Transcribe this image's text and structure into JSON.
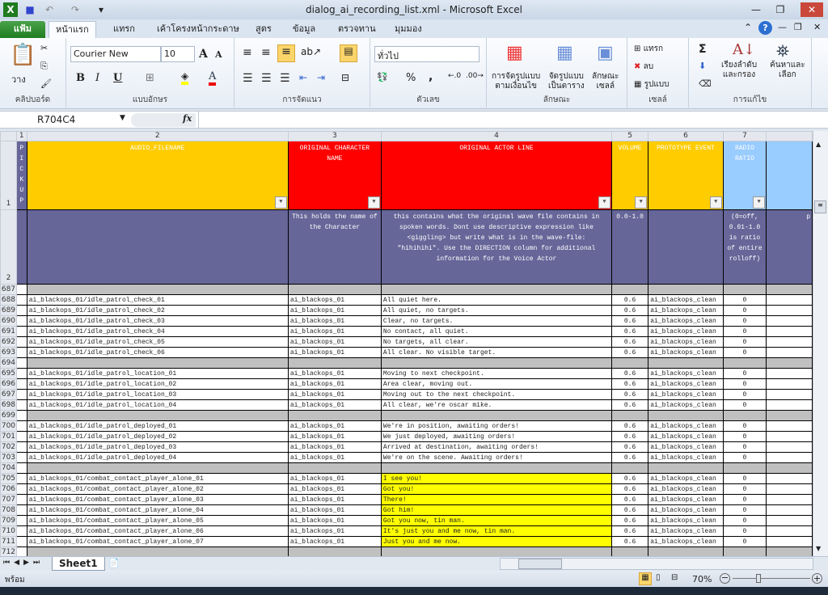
{
  "window": {
    "title": "dialog_ai_recording_list.xml - Microsoft Excel"
  },
  "quick_access": {
    "save": "save-icon",
    "undo": "undo-icon",
    "redo": "redo-icon"
  },
  "tabs": [
    {
      "label": "แฟ้ม"
    },
    {
      "label": "หน้าแรก"
    },
    {
      "label": "แทรก"
    },
    {
      "label": "เค้าโครงหน้ากระดาษ"
    },
    {
      "label": "สูตร"
    },
    {
      "label": "ข้อมูล"
    },
    {
      "label": "ตรวจทาน"
    },
    {
      "label": "มุมมอง"
    }
  ],
  "ribbon": {
    "clipboard": {
      "paste": "วาง",
      "label": "คลิปบอร์ด"
    },
    "font": {
      "name": "Courier New",
      "size": "10",
      "bold": "B",
      "italic": "I",
      "underline": "U",
      "label": "แบบอักษร"
    },
    "alignment": {
      "label": "การจัดแนว"
    },
    "number": {
      "format": "ทั่วไป",
      "percent": "%",
      "comma": ",",
      "label": "ตัวเลข"
    },
    "styles": {
      "conditional": [
        "การจัดรูปแบบ",
        "ตามเงื่อนไข"
      ],
      "table": [
        "จัดรูปแบบ",
        "เป็นตาราง"
      ],
      "cell": [
        "ลักษณะ",
        "เซลล์"
      ],
      "label": "ลักษณะ"
    },
    "cells": {
      "insert": "แทรก",
      "delete": "ลบ",
      "format": "รูปแบบ",
      "label": "เซลล์"
    },
    "editing": {
      "sum": "Σ",
      "sort": [
        "เรียงลำดับ",
        "และกรอง"
      ],
      "find": [
        "ค้นหาและ",
        "เลือก"
      ],
      "label": "การแก้ไข"
    }
  },
  "formula_bar": {
    "name_box": "R704C4",
    "fx": "fx",
    "value": ""
  },
  "columns": [
    "1",
    "2",
    "3",
    "4",
    "5",
    "6",
    "7",
    ""
  ],
  "header_row": {
    "num": "1",
    "pickup": "P I C K U P",
    "cells": [
      "AUDIO_FILENAME",
      "ORIGINAL CHARACTER NAME",
      "ORIGINAL ACTOR LINE",
      "VOLUME",
      "PROTOTYPE EVENT",
      "RADIO RATIO",
      ""
    ]
  },
  "header_colors": [
    "#ffcc00",
    "#ff0000",
    "#ff0000",
    "#ffcc00",
    "#ffcc00",
    "#99ccff",
    "#99ccff"
  ],
  "desc_row": {
    "num": "2",
    "cells": [
      "",
      "This holds the name of the Character",
      "this contains what the original wave file contains in spoken words. Dont use descriptive expression like <giggling> but write what is in the wave-file: \"hihihihi\". Use the DIRECTION column for additional information for the Voice Actor",
      "0.0-1.0",
      "",
      "(0=off, 0.01-1.0 is ratio of entire rolloff)",
      "p"
    ]
  },
  "rows": [
    {
      "num": "687",
      "blank": true
    },
    {
      "num": "688",
      "file": "ai_blackops_01/idle_patrol_check_01",
      "char": "ai_blackops_01",
      "line": "All quiet here.",
      "vol": "0.6",
      "event": "ai_blackops_clean",
      "radio": "0"
    },
    {
      "num": "689",
      "file": "ai_blackops_01/idle_patrol_check_02",
      "char": "ai_blackops_01",
      "line": "All quiet, no targets.",
      "vol": "0.6",
      "event": "ai_blackops_clean",
      "radio": "0"
    },
    {
      "num": "690",
      "file": "ai_blackops_01/idle_patrol_check_03",
      "char": "ai_blackops_01",
      "line": "Clear, no targets.",
      "vol": "0.6",
      "event": "ai_blackops_clean",
      "radio": "0"
    },
    {
      "num": "691",
      "file": "ai_blackops_01/idle_patrol_check_04",
      "char": "ai_blackops_01",
      "line": "No contact, all quiet.",
      "vol": "0.6",
      "event": "ai_blackops_clean",
      "radio": "0"
    },
    {
      "num": "692",
      "file": "ai_blackops_01/idle_patrol_check_05",
      "char": "ai_blackops_01",
      "line": "No targets, all clear.",
      "vol": "0.6",
      "event": "ai_blackops_clean",
      "radio": "0"
    },
    {
      "num": "693",
      "file": "ai_blackops_01/idle_patrol_check_06",
      "char": "ai_blackops_01",
      "line": "All clear. No visible target.",
      "vol": "0.6",
      "event": "ai_blackops_clean",
      "radio": "0"
    },
    {
      "num": "694",
      "blank": true
    },
    {
      "num": "695",
      "file": "ai_blackops_01/idle_patrol_location_01",
      "char": "ai_blackops_01",
      "line": "Moving to next checkpoint.",
      "vol": "0.6",
      "event": "ai_blackops_clean",
      "radio": "0"
    },
    {
      "num": "696",
      "file": "ai_blackops_01/idle_patrol_location_02",
      "char": "ai_blackops_01",
      "line": "Area clear, moving out.",
      "vol": "0.6",
      "event": "ai_blackops_clean",
      "radio": "0"
    },
    {
      "num": "697",
      "file": "ai_blackops_01/idle_patrol_location_03",
      "char": "ai_blackops_01",
      "line": "Moving out to the next checkpoint.",
      "vol": "0.6",
      "event": "ai_blackops_clean",
      "radio": "0"
    },
    {
      "num": "698",
      "file": "ai_blackops_01/idle_patrol_location_04",
      "char": "ai_blackops_01",
      "line": "All clear, we're oscar mike.",
      "vol": "0.6",
      "event": "ai_blackops_clean",
      "radio": "0"
    },
    {
      "num": "699",
      "blank": true
    },
    {
      "num": "700",
      "file": "ai_blackops_01/idle_patrol_deployed_01",
      "char": "ai_blackops_01",
      "line": "We're in position, awaiting orders!",
      "vol": "0.6",
      "event": "ai_blackops_clean",
      "radio": "0"
    },
    {
      "num": "701",
      "file": "ai_blackops_01/idle_patrol_deployed_02",
      "char": "ai_blackops_01",
      "line": "We just deployed, awaiting orders!",
      "vol": "0.6",
      "event": "ai_blackops_clean",
      "radio": "0"
    },
    {
      "num": "702",
      "file": "ai_blackops_01/idle_patrol_deployed_03",
      "char": "ai_blackops_01",
      "line": "Arrived at destination, awaiting orders!",
      "vol": "0.6",
      "event": "ai_blackops_clean",
      "radio": "0"
    },
    {
      "num": "703",
      "file": "ai_blackops_01/idle_patrol_deployed_04",
      "char": "ai_blackops_01",
      "line": "We're on the scene. Awaiting orders!",
      "vol": "0.6",
      "event": "ai_blackops_clean",
      "radio": "0"
    },
    {
      "num": "704",
      "blank": true
    },
    {
      "num": "705",
      "file": "ai_blackops_01/combat_contact_player_alone_01",
      "char": "ai_blackops_01",
      "line": "I see you!",
      "vol": "0.6",
      "event": "ai_blackops_clean",
      "radio": "0",
      "highlight": true
    },
    {
      "num": "706",
      "file": "ai_blackops_01/combat_contact_player_alone_02",
      "char": "ai_blackops_01",
      "line": "Got you!",
      "vol": "0.6",
      "event": "ai_blackops_clean",
      "radio": "0",
      "highlight": true
    },
    {
      "num": "707",
      "file": "ai_blackops_01/combat_contact_player_alone_03",
      "char": "ai_blackops_01",
      "line": "There!",
      "vol": "0.6",
      "event": "ai_blackops_clean",
      "radio": "0",
      "highlight": true
    },
    {
      "num": "708",
      "file": "ai_blackops_01/combat_contact_player_alone_04",
      "char": "ai_blackops_01",
      "line": "Got him!",
      "vol": "0.6",
      "event": "ai_blackops_clean",
      "radio": "0",
      "highlight": true
    },
    {
      "num": "709",
      "file": "ai_blackops_01/combat_contact_player_alone_05",
      "char": "ai_blackops_01",
      "line": "Got you now, tin man.",
      "vol": "0.6",
      "event": "ai_blackops_clean",
      "radio": "0",
      "highlight": true
    },
    {
      "num": "710",
      "file": "ai_blackops_01/combat_contact_player_alone_06",
      "char": "ai_blackops_01",
      "line": "It's just you and me now, tin man.",
      "vol": "0.6",
      "event": "ai_blackops_clean",
      "radio": "0",
      "highlight": true
    },
    {
      "num": "711",
      "file": "ai_blackops_01/combat_contact_player_alone_07",
      "char": "ai_blackops_01",
      "line": "Just you and me now.",
      "vol": "0.6",
      "event": "ai_blackops_clean",
      "radio": "0",
      "highlight": true
    },
    {
      "num": "712",
      "blank": true
    }
  ],
  "sheets": [
    {
      "label": "Sheet1"
    }
  ],
  "status": {
    "ready": "พร้อม",
    "zoom": "70%",
    "zoom_level": 70
  }
}
